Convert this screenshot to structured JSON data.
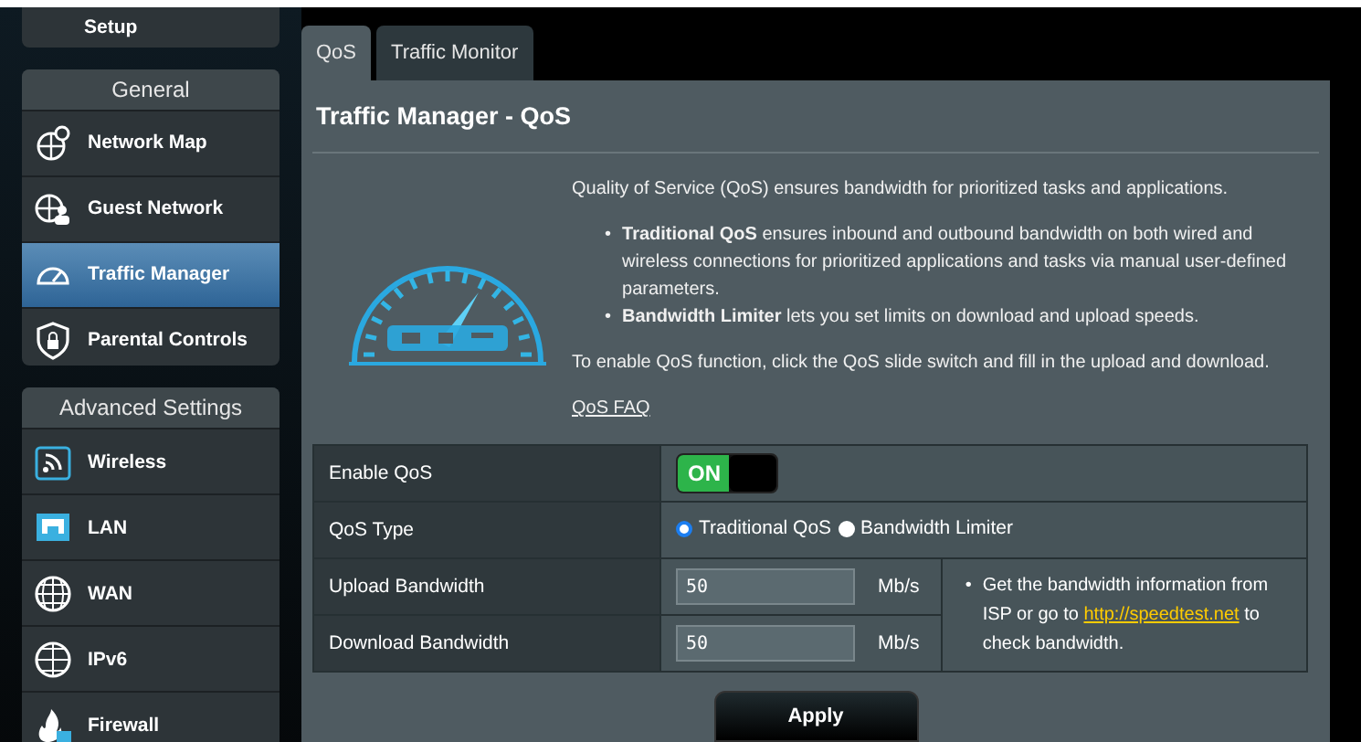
{
  "sidebar": {
    "top_item": {
      "label": "Setup"
    },
    "groups": [
      {
        "title": "General",
        "items": [
          {
            "label": "Network Map",
            "selected": false
          },
          {
            "label": "Guest Network",
            "selected": false
          },
          {
            "label": "Traffic Manager",
            "selected": true
          },
          {
            "label": "Parental Controls",
            "selected": false
          }
        ]
      },
      {
        "title": "Advanced Settings",
        "items": [
          {
            "label": "Wireless",
            "selected": false
          },
          {
            "label": "LAN",
            "selected": false
          },
          {
            "label": "WAN",
            "selected": false
          },
          {
            "label": "IPv6",
            "selected": false
          },
          {
            "label": "Firewall",
            "selected": false
          }
        ]
      }
    ]
  },
  "tabs": [
    {
      "label": "QoS",
      "selected": true
    },
    {
      "label": "Traffic Monitor",
      "selected": false
    }
  ],
  "page_title": "Traffic Manager - QoS",
  "intro": "Quality of Service (QoS) ensures bandwidth for prioritized tasks and applications.",
  "bullet_marker": "•",
  "bullets": [
    "**Traditional QoS** ensures inbound and outbound bandwidth on both wired and wireless connections for prioritized applications and tasks via manual user-defined parameters.",
    "**Bandwidth Limiter** lets you set limits on download and upload speeds."
  ],
  "instruction": "To enable QoS function, click the QoS slide switch and fill in the upload and download.",
  "faq_link": "QoS FAQ",
  "settings": {
    "enable": {
      "label": "Enable QoS",
      "on": true,
      "on_text": "ON"
    },
    "qos_type": {
      "label": "QoS Type",
      "options": [
        {
          "label": "Traditional QoS",
          "selected": true
        },
        {
          "label": "Bandwidth Limiter",
          "selected": false
        }
      ]
    },
    "bandwidth": [
      {
        "label": "Upload Bandwidth",
        "value": "50",
        "unit": "Mb/s"
      },
      {
        "label": "Download Bandwidth",
        "value": "50",
        "unit": "Mb/s"
      }
    ],
    "hint": {
      "marker": "•",
      "before": "Get the bandwidth information from ISP or go to",
      "link": "http://speedtest.net",
      "after": "to check bandwidth."
    }
  },
  "apply_button": "Apply"
}
